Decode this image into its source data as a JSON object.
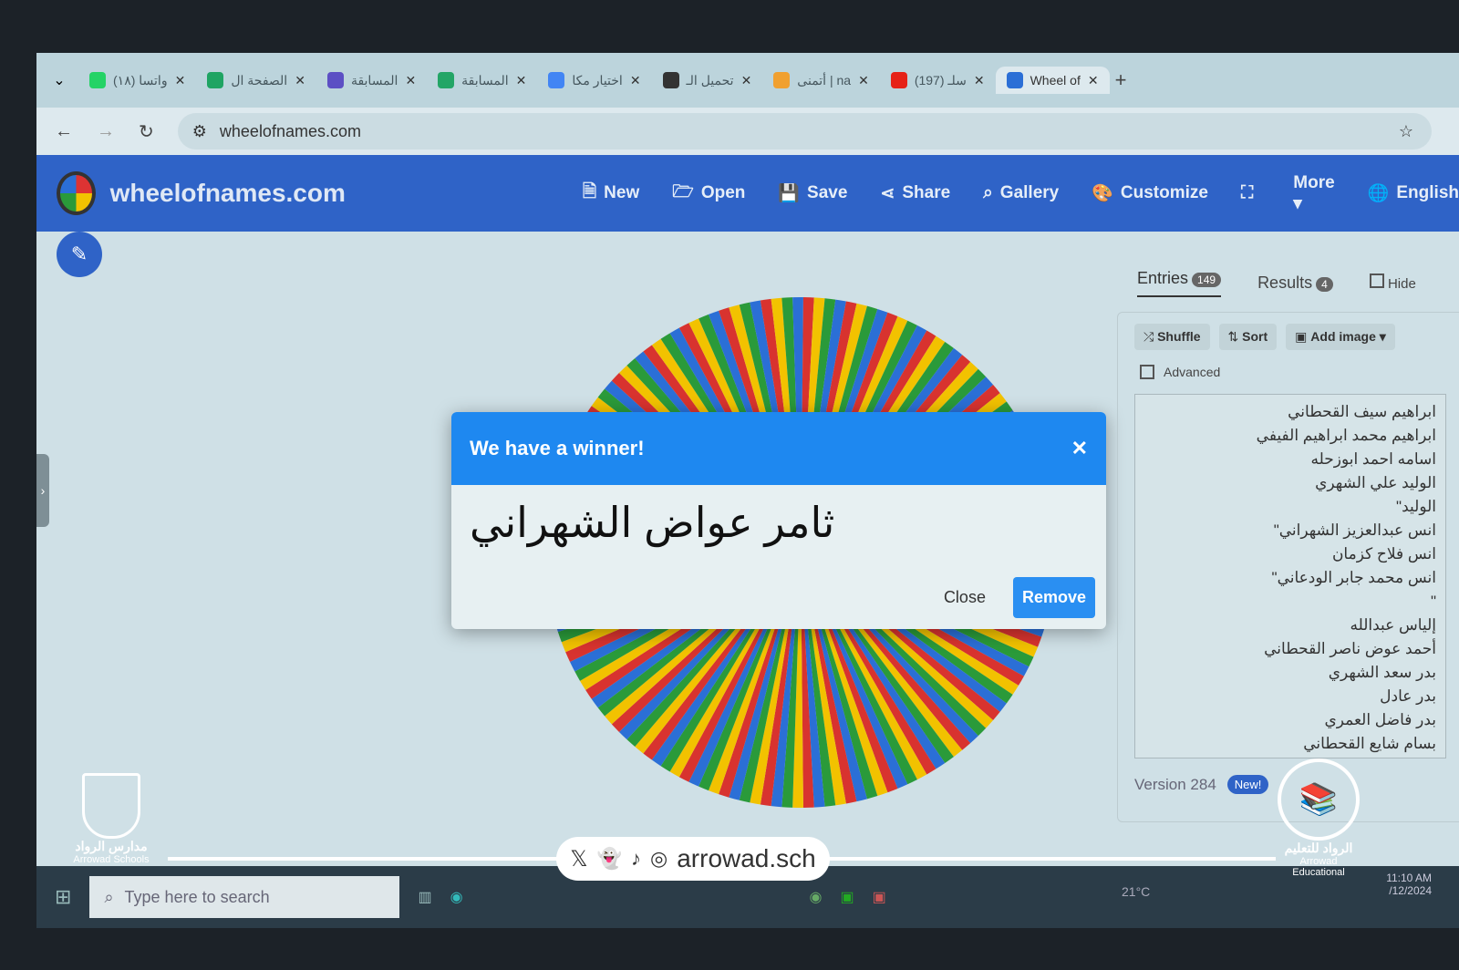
{
  "browser": {
    "tabs": [
      {
        "label": "(١٨) واتسا",
        "color": "#25d366"
      },
      {
        "label": "الصفحة ال",
        "color": "#1fa463"
      },
      {
        "label": "المسابقة",
        "color": "#5c4fc4"
      },
      {
        "label": "المسابقة",
        "color": "#23a566"
      },
      {
        "label": "اختيار مكا",
        "color": "#4285f4"
      },
      {
        "label": "تحميل الـ",
        "color": "#333333"
      },
      {
        "label": "أتمنى | na",
        "color": "#f0a030"
      },
      {
        "label": "(197) سلـ",
        "color": "#e62117"
      },
      {
        "label": "Wheel of",
        "color": "#2b6fd6"
      }
    ],
    "url": "wheelofnames.com"
  },
  "header": {
    "brand": "wheelofnames.com",
    "menu": [
      {
        "label": "New",
        "icon": "file-icon"
      },
      {
        "label": "Open",
        "icon": "folder-icon"
      },
      {
        "label": "Save",
        "icon": "save-icon"
      },
      {
        "label": "Share",
        "icon": "share-icon"
      },
      {
        "label": "Gallery",
        "icon": "search-icon"
      },
      {
        "label": "Customize",
        "icon": "palette-icon"
      },
      {
        "label": "",
        "icon": "fullscreen-icon"
      },
      {
        "label": "More ▾",
        "icon": ""
      },
      {
        "label": "English",
        "icon": "globe-icon"
      }
    ]
  },
  "wheel": {
    "colors": [
      "#d8332f",
      "#f2c200",
      "#2a9a3a",
      "#2b6fd6"
    ],
    "segments": 149
  },
  "dialog": {
    "title": "We have a winner!",
    "winner": "ثامر عواض الشهراني",
    "close": "Close",
    "remove": "Remove"
  },
  "panel": {
    "entries_tab": "Entries",
    "entries_count": "149",
    "results_tab": "Results",
    "results_count": "4",
    "hide": "Hide",
    "shuffle": "Shuffle",
    "sort": "Sort",
    "add_image": "Add image ▾",
    "advanced": "Advanced",
    "entries": [
      "ابراهيم سيف القحطاني",
      "ابراهيم محمد ابراهيم الفيفي",
      "اسامه احمد ابوزحله",
      "الوليد علي الشهري",
      "الوليد\"",
      "انس عبدالعزيز الشهراني\"",
      "انس فلاح كزمان",
      "انس محمد جابر الودعاني\"",
      "\"",
      "إلياس عبدالله",
      "أحمد عوض ناصر القحطاني",
      "بدر سعد الشهري",
      "بدر عادل",
      "بدر فاضل العمري",
      "بسام شايع القحطاني"
    ],
    "version": "Version 284",
    "new_badge": "New!"
  },
  "taskbar": {
    "search_placeholder": "Type here to search",
    "temperature": "21°C",
    "time": "11:10 AM",
    "date": "/12/2024"
  },
  "watermark": {
    "social_handle": "arrowad.sch",
    "left_ar": "مدارس الرواد",
    "left_en": "Arrowad Schools",
    "right_ar": "الرواد للتعليم",
    "right_en": "Arrowad Educational"
  }
}
